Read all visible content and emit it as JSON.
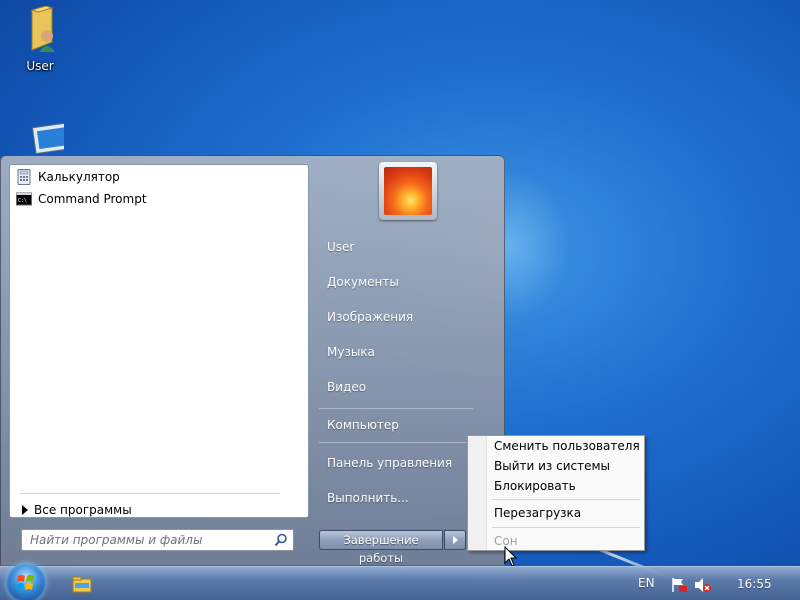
{
  "desktop": {
    "icons": [
      {
        "label": "User",
        "icon": "user-folder-icon"
      },
      {
        "label": "",
        "icon": "computer-icon"
      }
    ]
  },
  "start_menu": {
    "programs": [
      {
        "label": "Калькулятор",
        "icon": "calculator-icon"
      },
      {
        "label": "Command Prompt",
        "icon": "command-prompt-icon"
      }
    ],
    "all_programs": "Все программы",
    "search_placeholder": "Найти программы и файлы",
    "right_items": {
      "user": "User",
      "documents": "Документы",
      "pictures": "Изображения",
      "music": "Музыка",
      "video": "Видео",
      "computer": "Компьютер",
      "control_panel": "Панель управления",
      "run": "Выполнить..."
    },
    "shutdown_label": "Завершение работы"
  },
  "shutdown_menu": {
    "switch_user": "Сменить пользователя",
    "log_off": "Выйти из системы",
    "lock": "Блокировать",
    "restart": "Перезагрузка",
    "sleep": "Сон"
  },
  "taskbar": {
    "language": "EN",
    "clock": "16:55"
  },
  "colors": {
    "desktop_blue": "#1f6fd0",
    "taskbar": "#5f7daa"
  }
}
